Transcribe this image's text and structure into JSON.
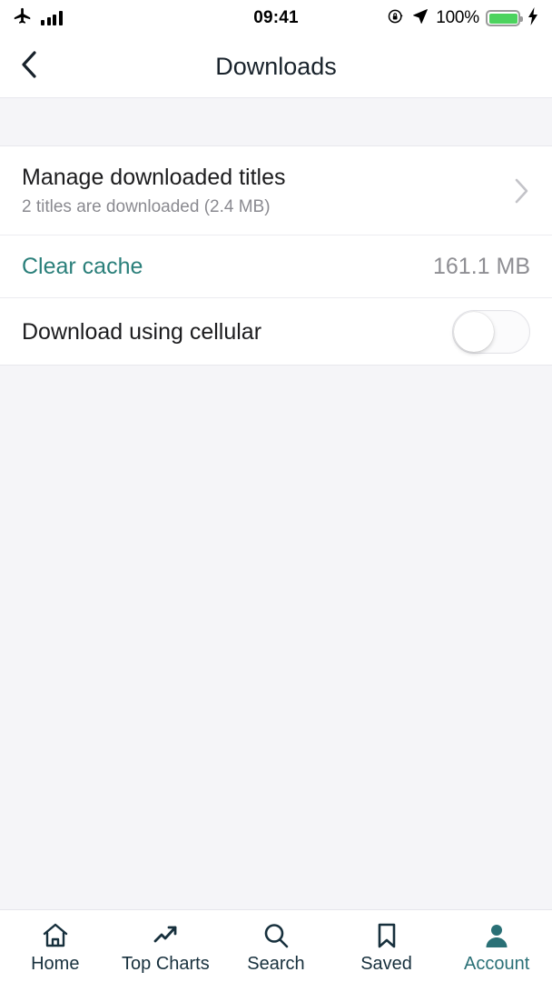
{
  "status_bar": {
    "airplane_icon": "airplane-mode-icon",
    "signal_icon": "signal-bars-icon",
    "time": "09:41",
    "rotation_lock_icon": "rotation-lock-icon",
    "location_icon": "location-arrow-icon",
    "battery_percent": "100%",
    "battery_icon": "battery-full-icon",
    "charging_icon": "lightning-bolt-icon",
    "battery_color": "#4cd35e"
  },
  "header": {
    "back_icon": "chevron-left-icon",
    "title": "Downloads"
  },
  "settings": {
    "manage": {
      "title": "Manage downloaded titles",
      "subtitle": "2 titles are downloaded (2.4 MB)",
      "chevron_icon": "chevron-right-icon"
    },
    "clear_cache": {
      "title": "Clear cache",
      "value": "161.1 MB",
      "title_color": "#2a7f7a"
    },
    "cellular": {
      "title": "Download using cellular",
      "toggle_state": "off"
    }
  },
  "tabbar": {
    "active_color": "#2a7076",
    "inactive_color": "#17303d",
    "items": [
      {
        "label": "Home",
        "icon": "home-icon",
        "active": false
      },
      {
        "label": "Top Charts",
        "icon": "trending-up-icon",
        "active": false
      },
      {
        "label": "Search",
        "icon": "search-icon",
        "active": false
      },
      {
        "label": "Saved",
        "icon": "bookmark-icon",
        "active": false
      },
      {
        "label": "Account",
        "icon": "person-icon",
        "active": true
      }
    ]
  }
}
